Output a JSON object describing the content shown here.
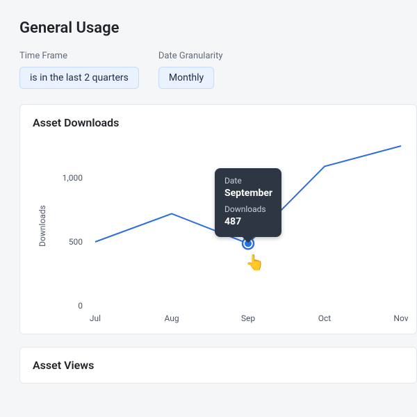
{
  "page": {
    "title": "General Usage"
  },
  "filters": {
    "timeframe": {
      "label": "Time Frame",
      "value": "is in the last 2 quarters"
    },
    "granularity": {
      "label": "Date Granularity",
      "value": "Monthly"
    }
  },
  "cards": {
    "downloads": {
      "title": "Asset Downloads"
    },
    "views": {
      "title": "Asset Views"
    }
  },
  "chart_data": {
    "type": "line",
    "title": "Asset Downloads",
    "xlabel": "",
    "ylabel": "Downloads",
    "categories": [
      "Jul",
      "Aug",
      "Sep",
      "Oct",
      "Nov"
    ],
    "values": [
      500,
      720,
      487,
      1090,
      1250
    ],
    "ylim": [
      0,
      1250
    ],
    "yticks": [
      0,
      500,
      1000
    ],
    "hover": {
      "index": 2,
      "date_label": "Date",
      "date_value": "September",
      "metric_label": "Downloads",
      "metric_value": "487"
    }
  }
}
